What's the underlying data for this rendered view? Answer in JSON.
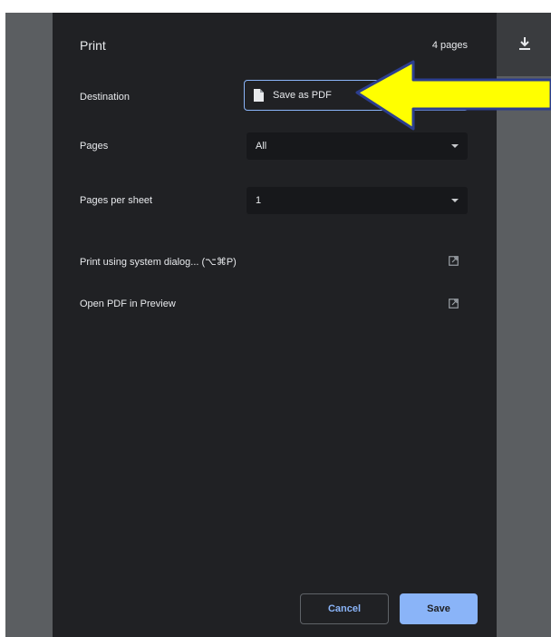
{
  "dialog": {
    "title": "Print",
    "page_count": "4 pages"
  },
  "destination": {
    "label": "Destination",
    "value": "Save as PDF",
    "icon": "file-icon"
  },
  "pages": {
    "label": "Pages",
    "value": "All"
  },
  "pages_per_sheet": {
    "label": "Pages per sheet",
    "value": "1"
  },
  "links": {
    "system_dialog": "Print using system dialog... (⌥⌘P)",
    "open_preview": "Open PDF in Preview"
  },
  "buttons": {
    "cancel": "Cancel",
    "save": "Save"
  },
  "annotation": {
    "arrow_color": "#ffff00",
    "arrow_outline": "#2c3e8f"
  },
  "colors": {
    "dialog_bg": "#202124",
    "accent": "#8ab4f8"
  }
}
